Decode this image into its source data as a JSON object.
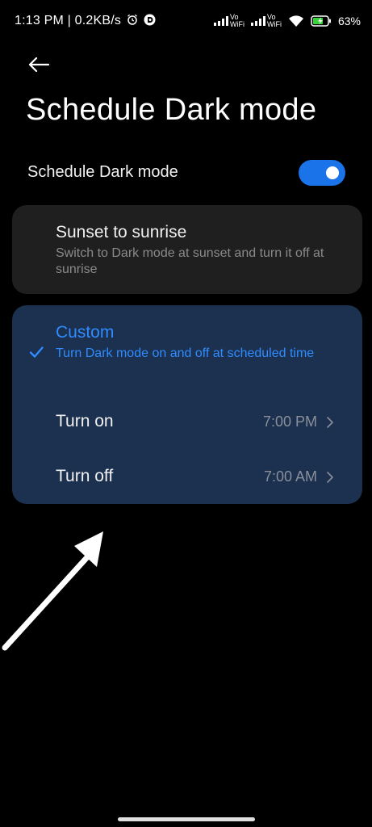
{
  "status_bar": {
    "time": "1:13 PM | 0.2KB/s",
    "vowifi_1_top": "Vo",
    "vowifi_1_bottom": "WiFi",
    "vowifi_2_top": "Vo",
    "vowifi_2_bottom": "WiFi",
    "battery": "63%",
    "icons": [
      "alarm-icon",
      "notification-icon",
      "signal-icon",
      "signal-icon",
      "wifi-icon",
      "battery-charging-icon"
    ]
  },
  "header": {
    "back_icon": "back-arrow-icon",
    "title": "Schedule Dark mode"
  },
  "toggle": {
    "label": "Schedule Dark mode",
    "state": "on",
    "accent": "#1a73e8"
  },
  "options": [
    {
      "title": "Sunset to sunrise",
      "description": "Switch to Dark mode at sunset and turn it off at sunrise",
      "selected": false
    },
    {
      "title": "Custom",
      "description": "Turn Dark mode on and off at scheduled time",
      "selected": true,
      "rows": [
        {
          "label": "Turn on",
          "value": "7:00 PM"
        },
        {
          "label": "Turn off",
          "value": "7:00 AM"
        }
      ]
    }
  ],
  "colors": {
    "background": "#000000",
    "card": "#1f1f1f",
    "selected_card": "#1c3050",
    "selected_text": "#2f8cff"
  }
}
